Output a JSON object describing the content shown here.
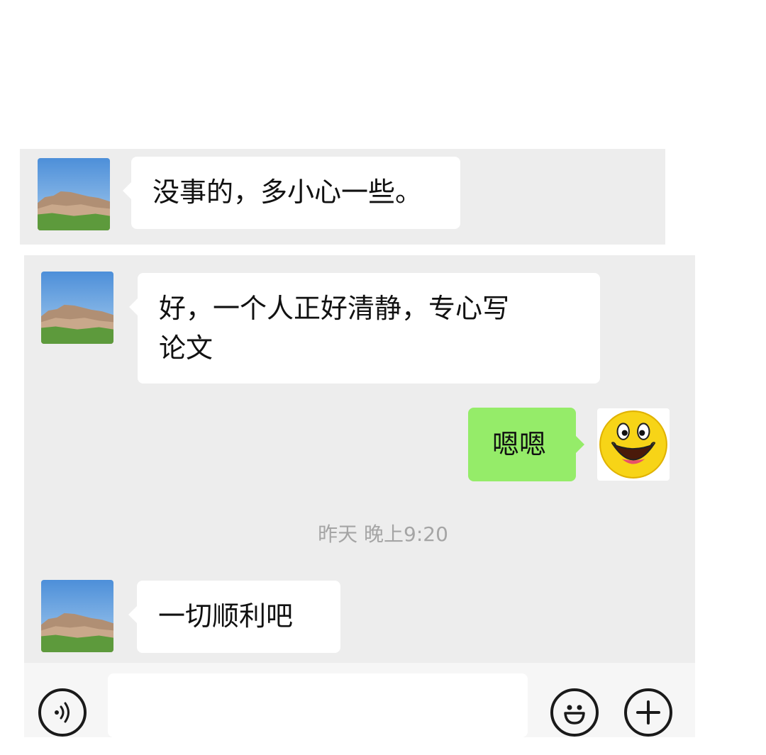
{
  "messages": [
    {
      "side": "left",
      "text": "没事的，多小心一些。"
    },
    {
      "side": "left",
      "text_line1": "好，一个人正好清静，专心写",
      "text_line2": "论文"
    },
    {
      "side": "right",
      "text": "嗯嗯"
    },
    {
      "side": "left",
      "text": "一切顺利吧"
    }
  ],
  "timestamp": "昨天 晚上9:20",
  "input": {
    "value": "",
    "placeholder": ""
  },
  "icons": {
    "voice": "voice-icon",
    "emoji": "emoji-icon",
    "add": "plus-icon",
    "contact_avatar": "mountain-landscape-avatar",
    "self_avatar": "smiley-face-avatar"
  },
  "colors": {
    "chat_bg": "#ededed",
    "incoming_bubble": "#ffffff",
    "outgoing_bubble": "#95ec69",
    "timestamp_text": "#a5a5a5"
  }
}
